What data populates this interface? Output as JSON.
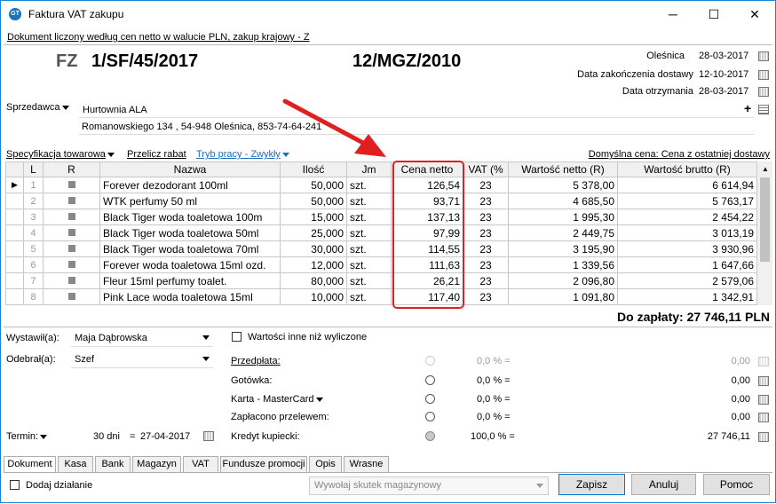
{
  "window": {
    "title": "Faktura VAT zakupu",
    "controls": [
      "─",
      "☐",
      "✕"
    ]
  },
  "header": {
    "subtitle": "Dokument liczony według cen netto w walucie PLN, zakup krajowy - Z",
    "doc_type": "FZ",
    "doc_number": "1/SF/45/2017",
    "ext_number": "12/MGZ/2010",
    "dates": [
      {
        "label": "Oleśnica",
        "value": "28-03-2017"
      },
      {
        "label": "Data zakończenia dostawy",
        "value": "12-10-2017"
      },
      {
        "label": "Data otrzymania",
        "value": "28-03-2017"
      }
    ]
  },
  "seller": {
    "label": "Sprzedawca",
    "name": "Hurtownia ALA",
    "address": "Romanowskiego 134 , 54-948 Oleśnica, 853-74-64-241",
    "add_icon": "plus-icon",
    "details_icon": "list-icon"
  },
  "toolbar": {
    "specification": "Specyfikacja towarowa",
    "recalc": "Przelicz rabat",
    "mode": "Tryb pracy - Zwykły",
    "default_price": "Domyślna cena: Cena z ostatniej dostawy"
  },
  "table": {
    "columns": [
      "L",
      "R",
      "Nazwa",
      "Ilość",
      "Jm",
      "Cena netto",
      "VAT (%",
      "Wartość netto (R)",
      "Wartość brutto (R)"
    ],
    "rows": [
      {
        "l": "1",
        "name": "Forever dezodorant 100ml",
        "qty": "50,000",
        "unit": "szt.",
        "price": "126,54",
        "vat": "23",
        "net": "5 378,00",
        "gross": "6 614,94"
      },
      {
        "l": "2",
        "name": "WTK perfumy 50 ml",
        "qty": "50,000",
        "unit": "szt.",
        "price": "93,71",
        "vat": "23",
        "net": "4 685,50",
        "gross": "5 763,17"
      },
      {
        "l": "3",
        "name": "Black Tiger woda toaletowa 100m",
        "qty": "15,000",
        "unit": "szt.",
        "price": "137,13",
        "vat": "23",
        "net": "1 995,30",
        "gross": "2 454,22"
      },
      {
        "l": "4",
        "name": "Black Tiger woda toaletowa 50ml",
        "qty": "25,000",
        "unit": "szt.",
        "price": "97,99",
        "vat": "23",
        "net": "2 449,75",
        "gross": "3 013,19"
      },
      {
        "l": "5",
        "name": "Black Tiger woda toaletowa 70ml",
        "qty": "30,000",
        "unit": "szt.",
        "price": "114,55",
        "vat": "23",
        "net": "3 195,90",
        "gross": "3 930,96"
      },
      {
        "l": "6",
        "name": "Forever woda toaletowa 15ml ozd.",
        "qty": "12,000",
        "unit": "szt.",
        "price": "111,63",
        "vat": "23",
        "net": "1 339,56",
        "gross": "1 647,66"
      },
      {
        "l": "7",
        "name": "Fleur 15ml perfumy toalet.",
        "qty": "80,000",
        "unit": "szt.",
        "price": "26,21",
        "vat": "23",
        "net": "2 096,80",
        "gross": "2 579,06"
      },
      {
        "l": "8",
        "name": "Pink Lace woda toaletowa 15ml",
        "qty": "10,000",
        "unit": "szt.",
        "price": "117,40",
        "vat": "23",
        "net": "1 091,80",
        "gross": "1 342,91"
      }
    ]
  },
  "total": "Do zapłaty: 27 746,11 PLN",
  "footer_left": {
    "issued_label": "Wystawił(a):",
    "issued_value": "Maja Dąbrowska",
    "received_label": "Odebrał(a):",
    "received_value": "Szef",
    "term_label": "Termin:",
    "term_days": "30 dni",
    "term_eq": "=",
    "term_date": "27-04-2017"
  },
  "payments": {
    "other_values": "Wartości inne niż wyliczone",
    "rows": [
      {
        "label": "Przedpłata:",
        "pct": "0,0 % =",
        "amount": "0,00"
      },
      {
        "label": "Gotówka:",
        "pct": "0,0 % =",
        "amount": "0,00"
      },
      {
        "label": "Karta - MasterCard",
        "pct": "0,0 % =",
        "amount": "0,00"
      },
      {
        "label": "Zapłacono przelewem:",
        "pct": "0,0 % =",
        "amount": "0,00"
      },
      {
        "label": "Kredyt kupiecki:",
        "pct": "100,0 % =",
        "amount": "27 746,11"
      }
    ]
  },
  "tabs": [
    "Dokument",
    "Kasa",
    "Bank",
    "Magazyn",
    "VAT",
    "Fundusze promocji",
    "Opis",
    "Wrasne"
  ],
  "bottom": {
    "add_action": "Dodaj działanie",
    "warehouse_effect": "Wywołaj skutek magazynowy",
    "save": "Zapisz",
    "cancel": "Anuluj",
    "help": "Pomoc"
  },
  "colors": {
    "highlight": "#e02020",
    "accent": "#1c6fc2"
  }
}
